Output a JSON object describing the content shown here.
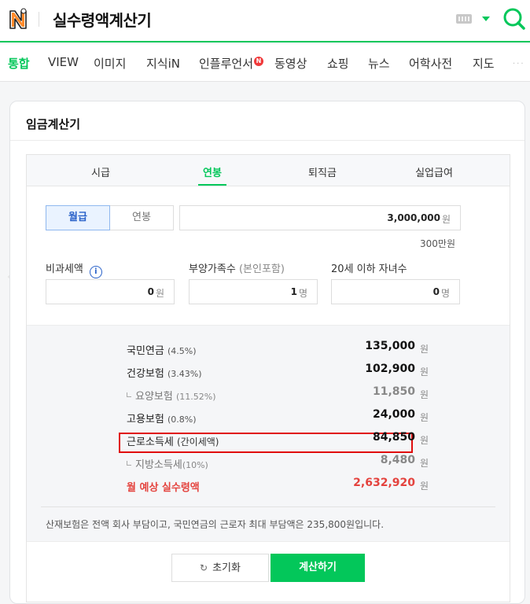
{
  "header": {
    "query": "실수령액계산기",
    "accent_color": "#03c75a",
    "logo_icon": "naver-logo-icon",
    "keyboard_icon": "keyboard-icon",
    "search_icon": "search-icon"
  },
  "tabs": [
    {
      "label": "통합",
      "active": true
    },
    {
      "label": "VIEW"
    },
    {
      "label": "이미지"
    },
    {
      "label": "지식iN"
    },
    {
      "label": "인플루언서",
      "badge": "N"
    },
    {
      "label": "동영상"
    },
    {
      "label": "쇼핑"
    },
    {
      "label": "뉴스"
    },
    {
      "label": "어학사전"
    },
    {
      "label": "지도"
    }
  ],
  "more": "···",
  "card": {
    "title": "임금계산기",
    "subtabs": [
      {
        "label": "시급"
      },
      {
        "label": "연봉",
        "active": true
      },
      {
        "label": "퇴직금"
      },
      {
        "label": "실업급여"
      }
    ],
    "pay_type": {
      "monthly": "월급",
      "annual": "연봉",
      "selected": "월급"
    },
    "salary": {
      "value": "3,000,000",
      "unit": "원",
      "hint": "300만원"
    },
    "nontax": {
      "label": "비과세액",
      "value": "0",
      "unit": "원"
    },
    "dependents": {
      "label": "부양가족수",
      "label_note": "(본인포함)",
      "value": "1",
      "unit": "명"
    },
    "children": {
      "label": "20세 이하 자녀수",
      "value": "0",
      "unit": "명"
    },
    "results": [
      {
        "label": "국민연금",
        "pct": "(4.5%)",
        "value": "135,000",
        "unit": "원"
      },
      {
        "label": "건강보험",
        "pct": "(3.43%)",
        "value": "102,900",
        "unit": "원"
      },
      {
        "label": "요양보험",
        "pct": "(11.52%)",
        "value": "11,850",
        "unit": "원"
      },
      {
        "label": "고용보험",
        "pct": "(0.8%)",
        "value": "24,000",
        "unit": "원"
      },
      {
        "label": "근로소득세",
        "pct": "(간이세액)",
        "value": "84,850",
        "unit": "원"
      },
      {
        "label": "지방소득세",
        "pct": "(10%)",
        "value": "8,480",
        "unit": "원"
      },
      {
        "label": "월 예상 실수령액",
        "value": "2,632,920",
        "unit": "원"
      }
    ],
    "note": "산재보험은 전액 회사 부담이고, 국민연금의 근로자 최대 부담액은 235,800원입니다.",
    "reset_label": "초기화",
    "calc_label": "계산하기"
  }
}
